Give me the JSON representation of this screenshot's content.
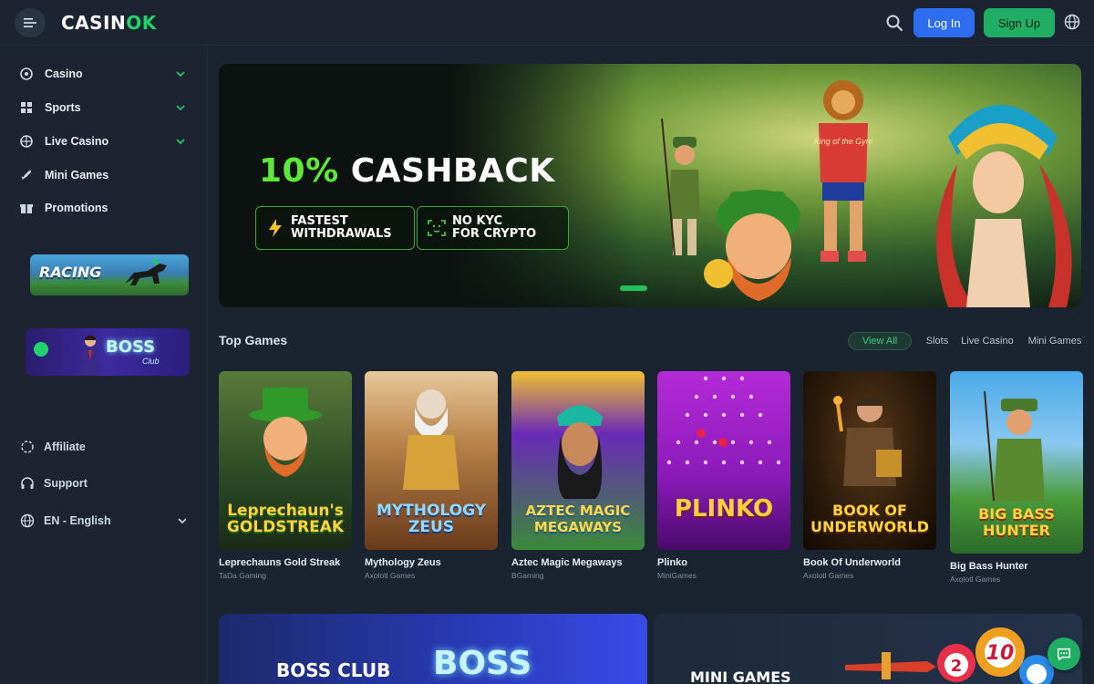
{
  "header": {
    "logo_main": "CASIN",
    "logo_ok": "OK",
    "login_label": "Log In",
    "signup_label": "Sign Up"
  },
  "sidebar": {
    "items": [
      {
        "label": "Casino",
        "icon": "slots-icon"
      },
      {
        "label": "Sports",
        "icon": "sports-icon"
      },
      {
        "label": "Live Casino",
        "icon": "live-icon"
      },
      {
        "label": "Mini Games",
        "icon": "rocket-icon"
      },
      {
        "label": "Promotions",
        "icon": "gift-icon"
      }
    ],
    "racing_banner": "RACING",
    "boss_banner": "BOSS",
    "boss_banner_sub": "Club",
    "affiliate": "Affiliate",
    "support": "Support",
    "language": "EN - English"
  },
  "hero": {
    "headline_pct": "10%",
    "headline_rest": " CASHBACK",
    "badge1_line1": "FASTEST",
    "badge1_line2": "WITHDRAWALS",
    "badge2_line1": "NO KYC",
    "badge2_line2": "FOR CRYPTO",
    "lion_shirt": "King of the Gym"
  },
  "top_games": {
    "title": "Top Games",
    "filters": [
      "View All",
      "Slots",
      "Live Casino",
      "Mini Games"
    ],
    "games": [
      {
        "name": "Leprechauns Gold Streak",
        "provider": "TaDa Gaming",
        "art": "Leprechaun's GOLDSTREAK"
      },
      {
        "name": "Mythology Zeus",
        "provider": "Axolotl Games",
        "art": "MYTHOLOGY ZEUS"
      },
      {
        "name": "Aztec Magic Megaways",
        "provider": "BGaming",
        "art": "AZTEC MAGIC MEGAWAYS"
      },
      {
        "name": "Plinko",
        "provider": "MiniGames",
        "art": "PLINKO"
      },
      {
        "name": "Book Of Underworld",
        "provider": "Axolotl Games",
        "art": "BOOK OF UNDERWORLD"
      },
      {
        "name": "Big Bass Hunter",
        "provider": "Axolotl Games",
        "art": "BIG BASS HUNTER"
      }
    ]
  },
  "cards": {
    "boss_club": "BOSS CLUB",
    "boss_logo": "BOSS",
    "mini_games": "MINI GAMES",
    "ball1": "2",
    "ball2": "10"
  },
  "colors": {
    "accent_green": "#1fae63",
    "login_blue": "#2f6df0",
    "bg": "#1a2330"
  }
}
